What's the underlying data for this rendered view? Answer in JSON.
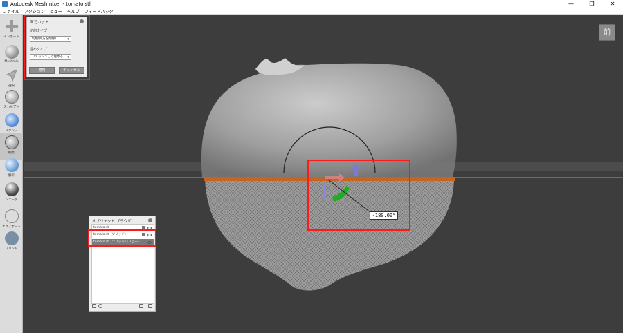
{
  "window": {
    "title": "Autodesk Meshmixer - tomato.stl",
    "minimize": "—",
    "maximize": "❐",
    "close": "✕"
  },
  "menu": [
    "ファイル",
    "アクション",
    "ビュー",
    "ヘルプ",
    "フィードバック"
  ],
  "toolbar": {
    "items": [
      {
        "label": "インポート",
        "icon": "plus-icon"
      },
      {
        "label": "Meshmix",
        "icon": "sphere-icon"
      },
      {
        "label": "選択",
        "icon": "arrow-icon"
      },
      {
        "label": "スカルプト",
        "icon": "brush-icon"
      },
      {
        "label": "スタンプ",
        "icon": "stamp-icon"
      },
      {
        "label": "編集",
        "icon": "edit-icon"
      },
      {
        "label": "解析",
        "icon": "analysis-icon"
      },
      {
        "label": "シェーダ",
        "icon": "shader-icon"
      },
      {
        "label": "エクスポート",
        "icon": "export-icon"
      },
      {
        "label": "プリント",
        "icon": "print-icon"
      }
    ],
    "active_index": 5
  },
  "view_cube": {
    "label": "前"
  },
  "plane_cut": {
    "title": "面でカット",
    "cut_type_label": "切削タイプ",
    "cut_type_value": "切削(片方を削除)",
    "fill_type_label": "埋めタイプ",
    "fill_type_value": "リメッシュして埋める",
    "apply_label": "適用",
    "cancel_label": "キャンセル"
  },
  "gizmo": {
    "angle_readout": "-180.00°"
  },
  "object_browser": {
    "title": "オブジェクト ブラウザ",
    "objects": [
      {
        "name": "tomato.stl",
        "selected": false
      },
      {
        "name": "tomato.stl (ソリッド)",
        "selected": false
      },
      {
        "name": "tomato.stl (ソリッド) (コピー)",
        "selected": true
      }
    ]
  },
  "colors": {
    "viewport_bg": "#3d3d3d",
    "highlight": "#ff1a1a",
    "cut_seam": "#c8641e"
  }
}
